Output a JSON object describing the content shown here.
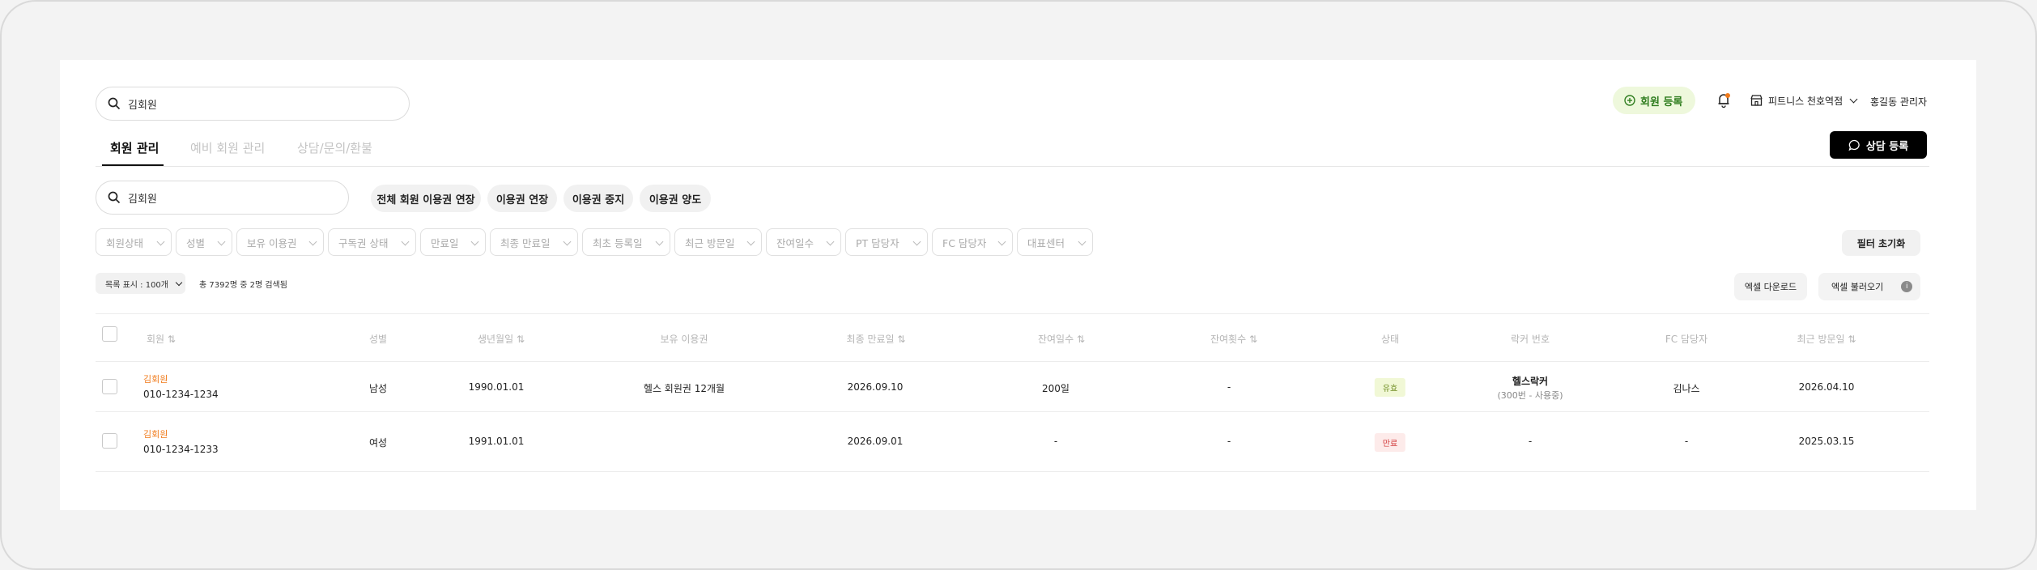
{
  "top": {
    "search_value": "김회원",
    "register_member": "회원 등록",
    "gym_name": "피트니스 천호역점",
    "admin_name": "홍길동 관리자"
  },
  "tabs": [
    {
      "label": "회원 관리",
      "active": true
    },
    {
      "label": "예비 회원 관리",
      "active": false
    },
    {
      "label": "상담/문의/환불",
      "active": false
    }
  ],
  "consult_register": "상담 등록",
  "search2_value": "김회원",
  "actions": [
    "전체 회원 이용권 연장",
    "이용권 연장",
    "이용권 중지",
    "이용권 양도"
  ],
  "filters": [
    "회원상태",
    "성별",
    "보유 이용권",
    "구독권 상태",
    "만료일",
    "최종 만료일",
    "최초 등록일",
    "최근 방문일",
    "잔여일수",
    "PT 담당자",
    "FC 담당자",
    "대표센터"
  ],
  "filter_reset": "필터 초기화",
  "page_size": "목록 표시 : 100개",
  "result_summary": "총 7392명 중 2명 검색됨",
  "excel_download": "엑셀 다운로드",
  "excel_upload": "엑셀 불러오기",
  "table": {
    "headers": [
      "회원",
      "성별",
      "생년월일",
      "보유 이용권",
      "최종 만료일",
      "잔여일수",
      "잔여횟수",
      "상태",
      "락커 번호",
      "FC 담당자",
      "최근 방문일"
    ],
    "rows": [
      {
        "name": "김회원",
        "phone": "010-1234-1234",
        "gender": "남성",
        "birth": "1990.01.01",
        "pass": "헬스 회원권 12개월",
        "expire": "2026.09.10",
        "remain_days": "200일",
        "remain_count": "-",
        "status": "유효",
        "locker": "헬스락커",
        "locker_sub": "(300번 - 사용중)",
        "fc": "김나스",
        "last_visit": "2026.04.10"
      },
      {
        "name": "김회원",
        "phone": "010-1234-1233",
        "gender": "여성",
        "birth": "1991.01.01",
        "pass": "",
        "expire": "2026.09.01",
        "remain_days": "-",
        "remain_count": "-",
        "status": "만료",
        "locker": "-",
        "locker_sub": "",
        "fc": "-",
        "last_visit": "2025.03.15"
      }
    ]
  },
  "colors": {
    "accent_orange": "#f07a1a",
    "register_green": "#2f7d1f",
    "register_bg": "#eef8dc"
  }
}
